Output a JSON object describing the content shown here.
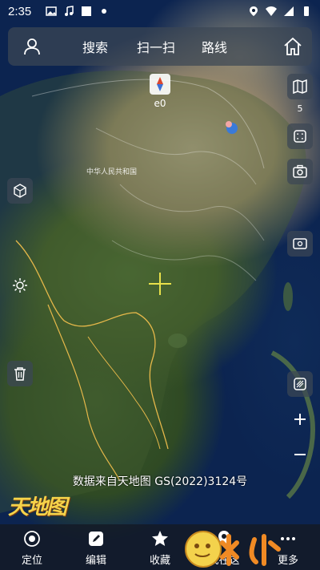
{
  "status_bar": {
    "time": "2:35"
  },
  "topbar": {
    "items": [
      {
        "label": "搜索"
      },
      {
        "label": "扫一扫"
      },
      {
        "label": "路线"
      }
    ]
  },
  "compass": {
    "label": "e0"
  },
  "layer": {
    "count": "5"
  },
  "map": {
    "labels": [
      "中华人民共和国"
    ]
  },
  "credit": "数据来自天地图 GS(2022)3124号",
  "logo_text": "天地图",
  "bottom_nav": {
    "items": [
      {
        "label": "定位"
      },
      {
        "label": "编辑"
      },
      {
        "label": "收藏"
      },
      {
        "label": "我在这"
      },
      {
        "label": "更多"
      }
    ]
  },
  "colors": {
    "panel": "#3c4655",
    "accent_yellow": "#e8e04a",
    "border_yellow": "#e6b84a",
    "logo": "#f5d34a",
    "watermark_orange": "#f08a24"
  }
}
